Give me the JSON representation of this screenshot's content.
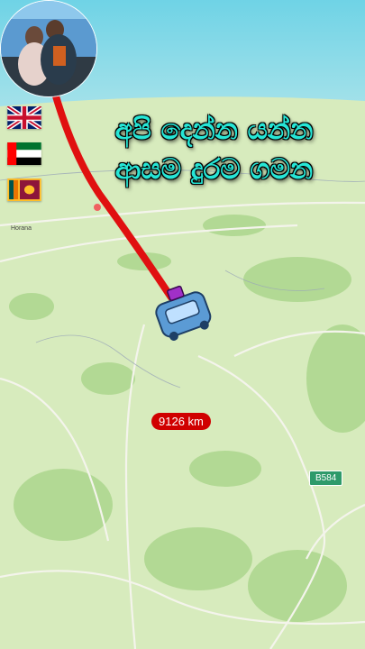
{
  "title": {
    "line1": "අපි දෙන්න යන්න",
    "line2": "ආසම දුරම ගමන"
  },
  "flags": [
    "uk-flag",
    "uae-flag",
    "sri-lanka-flag"
  ],
  "map": {
    "place_label": "Horana",
    "road_label": "B584",
    "route_color": "#e01010"
  },
  "distance_label": "9126 km",
  "colors": {
    "title": "#26e6d6",
    "map_land": "#cfe6b0",
    "vehicle": "#5b9bd5"
  }
}
